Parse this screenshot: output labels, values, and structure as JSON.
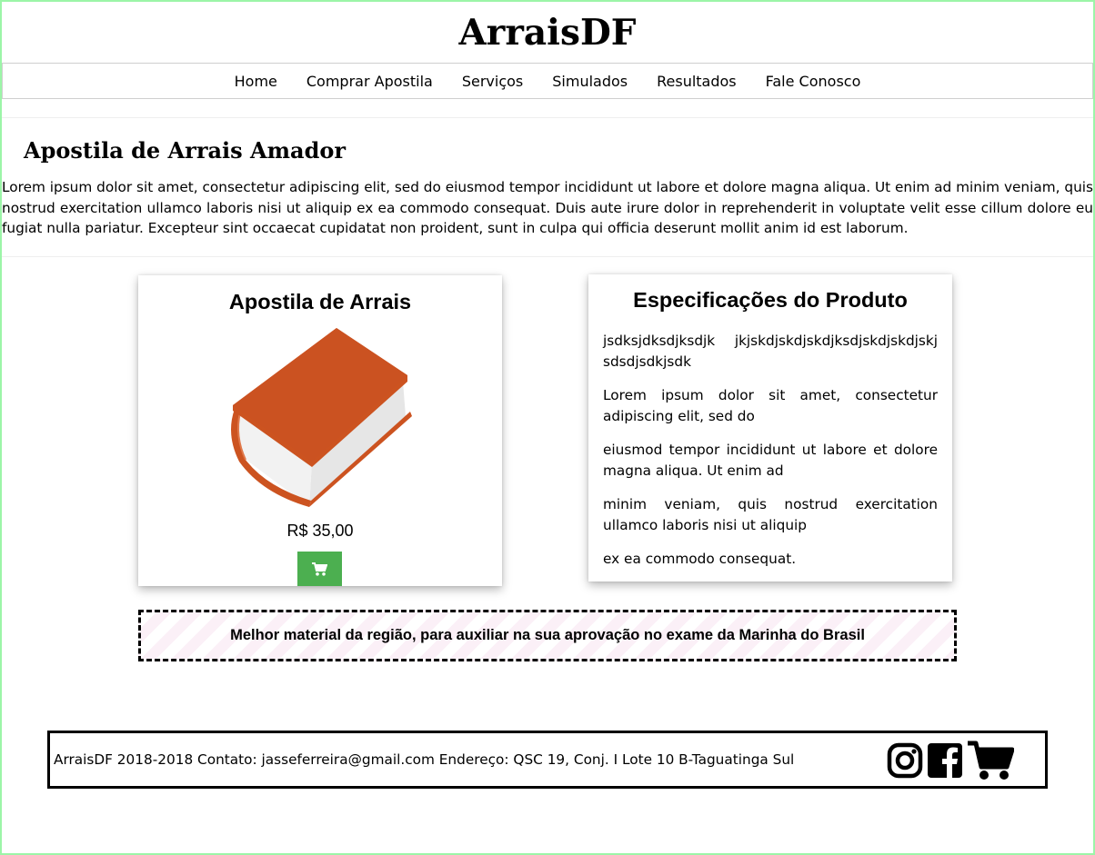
{
  "header": {
    "title": "ArraisDF"
  },
  "nav": {
    "items": [
      {
        "id": "home",
        "label": "Home"
      },
      {
        "id": "comprar-apostila",
        "label": "Comprar Apostila"
      },
      {
        "id": "servicos",
        "label": "Serviços"
      },
      {
        "id": "simulados",
        "label": "Simulados"
      },
      {
        "id": "resultados",
        "label": "Resultados"
      },
      {
        "id": "fale-conosco",
        "label": "Fale Conosco"
      }
    ]
  },
  "intro": {
    "heading": "Apostila de Arrais Amador",
    "text": "Lorem ipsum dolor sit amet, consectetur adipiscing elit, sed do eiusmod tempor incididunt ut labore et dolore magna aliqua. Ut enim ad minim veniam, quis nostrud exercitation ullamco laboris nisi ut aliquip ex ea commodo consequat. Duis aute irure dolor in reprehenderit in voluptate velit esse cillum dolore eu fugiat nulla pariatur. Excepteur sint occaecat cupidatat non proident, sunt in culpa qui officia deserunt mollit anim id est laborum."
  },
  "product": {
    "title": "Apostila de Arrais",
    "price": "R$ 35,00",
    "image_icon": "book-icon",
    "button_icon": "shopping-cart-icon",
    "button_color": "#4caf50"
  },
  "specs": {
    "title": "Especificações do Produto",
    "lines": [
      "jsdksjdksdjksdjk jkjskdjskdjskdjksdjskdjskdjskj sdsdjsdkjsdk",
      "Lorem ipsum dolor sit amet, consectetur adipiscing elit, sed do",
      "eiusmod tempor incididunt ut labore et dolore magna aliqua. Ut enim ad",
      "minim veniam, quis nostrud exercitation ullamco laboris nisi ut aliquip",
      "ex ea commodo consequat."
    ]
  },
  "banner": {
    "text": "Melhor material da região, para auxiliar na sua aprovação no exame da Marinha do Brasil"
  },
  "footer": {
    "text": "ArraisDF 2018-2018 Contato: jasseferreira@gmail.com Endereço: QSC 19, Conj. I Lote 10 B-Taguatinga Sul",
    "icons": [
      "instagram-icon",
      "facebook-icon",
      "shopping-cart-icon"
    ]
  },
  "colors": {
    "page_border": "#9cf5a8",
    "book_cover": "#cc5320",
    "cart_button": "#4caf50"
  }
}
